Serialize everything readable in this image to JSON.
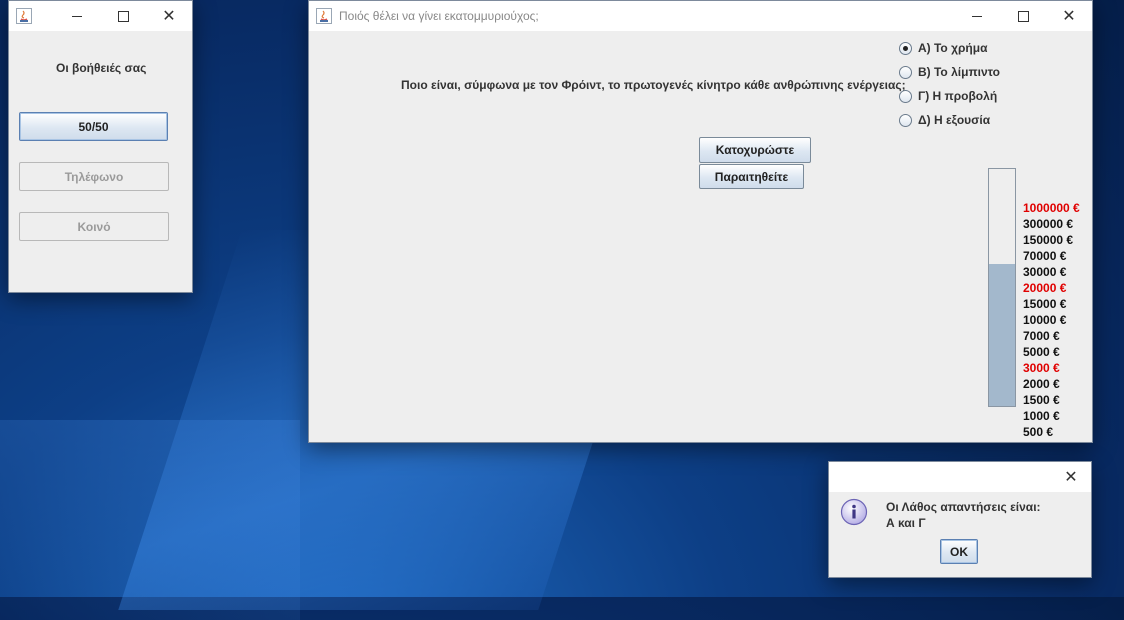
{
  "lifelines": {
    "title": "Οι βοήθειές σας",
    "buttons": [
      {
        "label": "50/50",
        "enabled": true
      },
      {
        "label": "Τηλέφωνο",
        "enabled": false
      },
      {
        "label": "Κοινό",
        "enabled": false
      }
    ]
  },
  "main": {
    "title": "Ποιός θέλει να γίνει εκατομμυριούχος;",
    "question": "Ποιο είναι, σύμφωνα με τον Φρόιντ, το πρωτογενές κίνητρο κάθε ανθρώπινης ενέργειας;",
    "answers": [
      {
        "label": "Α) Το χρήμα",
        "selected": true
      },
      {
        "label": "Β) Το λίμπιντο",
        "selected": false
      },
      {
        "label": "Γ) Η προβολή",
        "selected": false
      },
      {
        "label": "Δ) Η εξουσία",
        "selected": false
      }
    ],
    "submit_label": "Κατοχυρώστε",
    "quit_label": "Παραιτηθείτε",
    "progress_fraction": 0.6,
    "prizes": [
      {
        "label": "1000000 €",
        "safe": true
      },
      {
        "label": "300000 €",
        "safe": false
      },
      {
        "label": "150000 €",
        "safe": false
      },
      {
        "label": "70000 €",
        "safe": false
      },
      {
        "label": "30000 €",
        "safe": false
      },
      {
        "label": "20000 €",
        "safe": true
      },
      {
        "label": "15000 €",
        "safe": false
      },
      {
        "label": "10000 €",
        "safe": false
      },
      {
        "label": "7000 €",
        "safe": false
      },
      {
        "label": "5000 €",
        "safe": false
      },
      {
        "label": "3000 €",
        "safe": true
      },
      {
        "label": "2000 €",
        "safe": false
      },
      {
        "label": "1500 €",
        "safe": false
      },
      {
        "label": "1000 €",
        "safe": false
      },
      {
        "label": "500 €",
        "safe": false
      }
    ],
    "safe_color": "#e00000"
  },
  "dialog": {
    "message_line1": "Οι Λάθος απαντήσεις είναι:",
    "message_line2": "Α και Γ",
    "ok_label": "OK",
    "icon": "info-icon"
  }
}
